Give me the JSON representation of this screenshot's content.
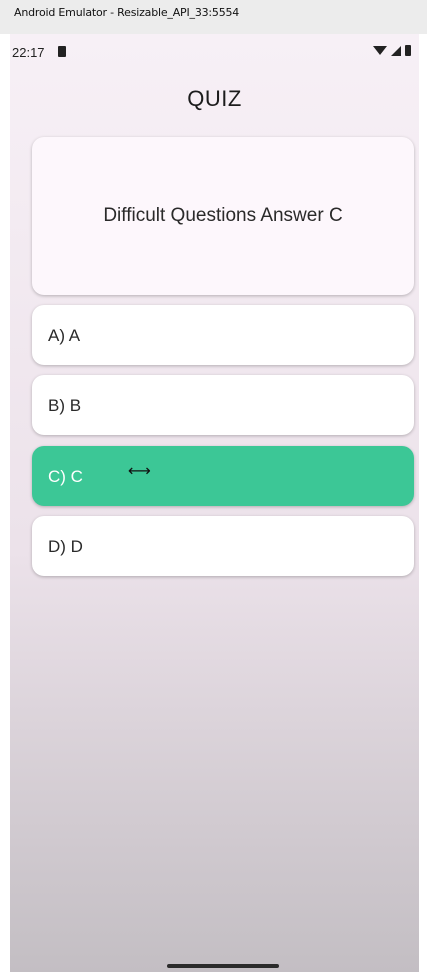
{
  "window": {
    "title": "Android Emulator - Resizable_API_33:5554"
  },
  "status_bar": {
    "time": "22:17",
    "icons": [
      "sim-card-icon",
      "wifi-icon",
      "cell-signal-icon",
      "battery-icon"
    ]
  },
  "app": {
    "title": "QUIZ"
  },
  "question": {
    "text": "Difficult Questions Answer C"
  },
  "options": [
    {
      "label": "A) A",
      "selected": false
    },
    {
      "label": "B) B",
      "selected": false
    },
    {
      "label": "C) C",
      "selected": true
    },
    {
      "label": "D) D",
      "selected": false
    }
  ],
  "colors": {
    "selected_option": "#3cc796",
    "card_background": "#fdf7fc",
    "option_background": "#ffffff"
  }
}
